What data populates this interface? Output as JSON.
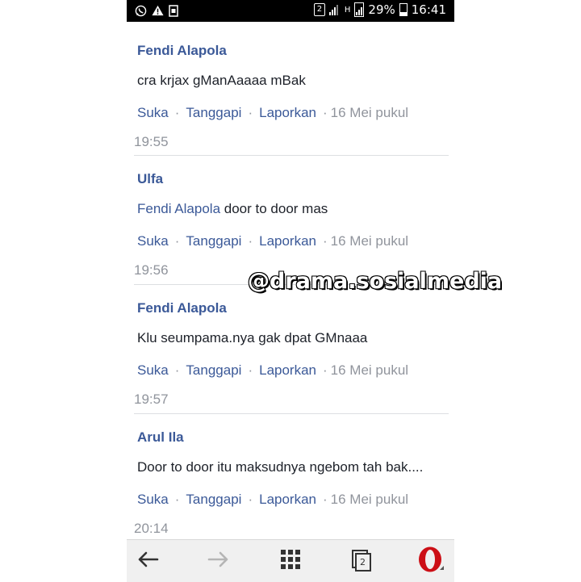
{
  "status_bar": {
    "sim_label": "2",
    "network_label": "H",
    "battery_percent": "29%",
    "time": "16:41"
  },
  "comments": [
    {
      "author": "Fendi Alapola",
      "mention": "",
      "text": "cra krjax gManAaaaa mBak",
      "like": "Suka",
      "reply": "Tanggapi",
      "report": "Laporkan",
      "date": "16 Mei pukul",
      "time": "19:55"
    },
    {
      "author": "Ulfa",
      "mention": "Fendi Alapola",
      "text": "door to door mas",
      "like": "Suka",
      "reply": "Tanggapi",
      "report": "Laporkan",
      "date": "16 Mei pukul",
      "time": "19:56"
    },
    {
      "author": "Fendi Alapola",
      "mention": "",
      "text": "Klu seumpama.nya gak dpat GMnaaa",
      "like": "Suka",
      "reply": "Tanggapi",
      "report": "Laporkan",
      "date": "16 Mei pukul",
      "time": "19:57"
    },
    {
      "author": "Arul Ila",
      "mention": "",
      "text": "Door to door itu maksudnya ngebom tah bak....",
      "like": "Suka",
      "reply": "Tanggapi",
      "report": "Laporkan",
      "date": "16 Mei pukul",
      "time": "20:14"
    }
  ],
  "action_separator": "·",
  "watermark": "@drama.sosialmedia",
  "nav_bar": {
    "tabs_count": "2",
    "icons": [
      "back-arrow-icon",
      "forward-arrow-icon",
      "speed-dial-grid-icon",
      "tabs-icon",
      "opera-logo-icon"
    ]
  },
  "colors": {
    "link": "#3b5998",
    "muted": "#90949c",
    "opera_red": "#cc0f16"
  }
}
